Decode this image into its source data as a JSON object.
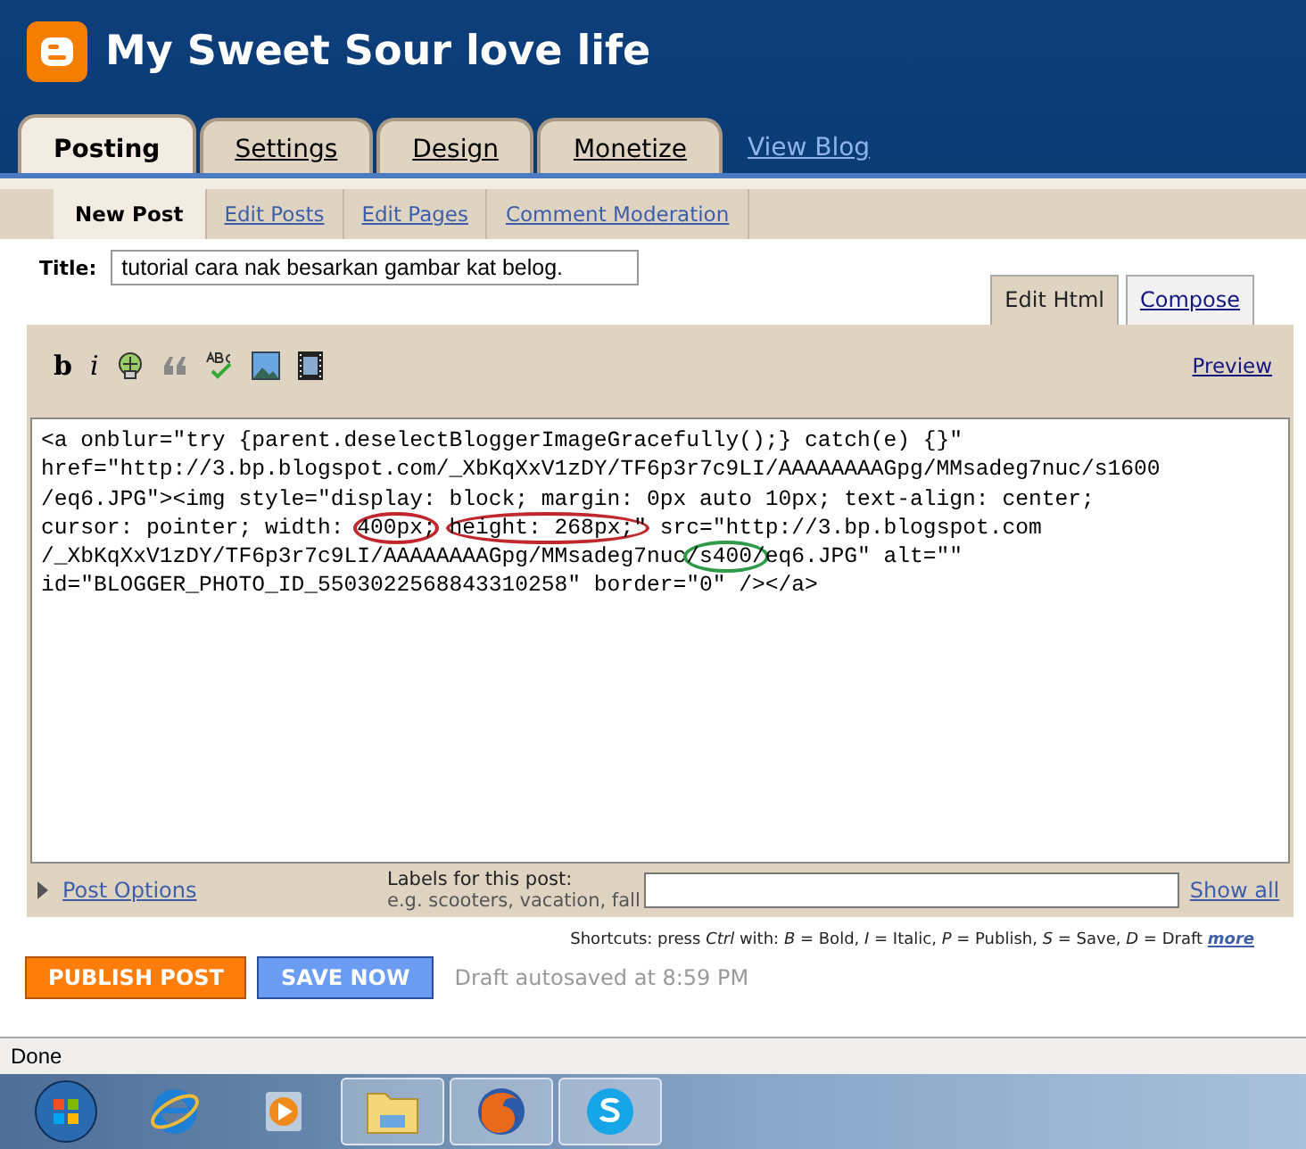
{
  "header": {
    "title": "My Sweet Sour love life"
  },
  "tabs": [
    {
      "label": "Posting",
      "selected": true
    },
    {
      "label": "Settings",
      "selected": false
    },
    {
      "label": "Design",
      "selected": false
    },
    {
      "label": "Monetize",
      "selected": false
    }
  ],
  "view_blog_link": "View Blog",
  "subtabs": [
    {
      "label": "New Post",
      "selected": true
    },
    {
      "label": "Edit Posts",
      "selected": false
    },
    {
      "label": "Edit Pages",
      "selected": false
    },
    {
      "label": "Comment Moderation",
      "selected": false
    }
  ],
  "title_field": {
    "label": "Title:",
    "value": "tutorial cara nak besarkan gambar kat belog."
  },
  "editor_tabs": [
    {
      "label": "Edit Html",
      "selected": true
    },
    {
      "label": "Compose",
      "selected": false
    }
  ],
  "toolbar": [
    {
      "kind": "bold",
      "label": "b"
    },
    {
      "kind": "italic",
      "label": "i"
    },
    {
      "kind": "link"
    },
    {
      "kind": "quote"
    },
    {
      "kind": "spellcheck"
    },
    {
      "kind": "image"
    },
    {
      "kind": "video"
    }
  ],
  "preview_link": "Preview",
  "code_lines": [
    [
      {
        "text": "<a onblur=\"try {parent.deselectBloggerImageGracefully();} catch(e) {}\""
      }
    ],
    [
      {
        "text": "href=\"http://3.bp.blogspot.com/_XbKqXxV1zDY/TF6p3r7c9LI/AAAAAAAAGpg/MMsadeg7nuc/s1600"
      }
    ],
    [
      {
        "text": "/eq6.JPG\"><img style=\"display: block; margin: 0px auto 10px; text-align: center;"
      }
    ],
    [
      {
        "text": "cursor: pointer; width: "
      },
      {
        "text": "400px;",
        "color": "#c0282d"
      },
      {
        "text": "height: 268px;\"",
        "color": "#c0282d"
      },
      {
        "text": " src=\"http://3.bp.blogspot.com"
      }
    ],
    [
      {
        "text": "/_XbKqXxV1zDY/TF6p3r7c9LI/AAAAAAAAGpg/MMsadeg7nuc"
      },
      {
        "text": "/s400/",
        "color": "#2e9a4a"
      },
      {
        "text": "eq6.JPG\" alt=\"\""
      }
    ],
    [
      {
        "text": "id=\"BLOGGER_PHOTO_ID_5503022568843310258\" border=\"0\" /></a>"
      }
    ]
  ],
  "post_options_link": "Post Options",
  "labels": {
    "label": "Labels for this post:",
    "hint": "e.g. scooters, vacation, fall",
    "show_all": "Show all"
  },
  "shortcuts": {
    "text": "Shortcuts: press *Ctrl* with: *B* = Bold, *I* = Italic, *P* = Publish, *S* = Save, *D* = Draft",
    "more": "more"
  },
  "buttons": [
    {
      "kind": "publish",
      "label": "PUBLISH POST"
    },
    {
      "kind": "save",
      "label": "SAVE NOW"
    }
  ],
  "autosave_status": "Draft autosaved at 8:59 PM",
  "status_bar": "Done",
  "taskbar": [
    {
      "kind": "start",
      "running": false
    },
    {
      "kind": "browser-e",
      "running": false
    },
    {
      "kind": "media",
      "running": false
    },
    {
      "kind": "folder",
      "running": true
    },
    {
      "kind": "fox",
      "running": true
    },
    {
      "kind": "chat",
      "running": true
    }
  ]
}
